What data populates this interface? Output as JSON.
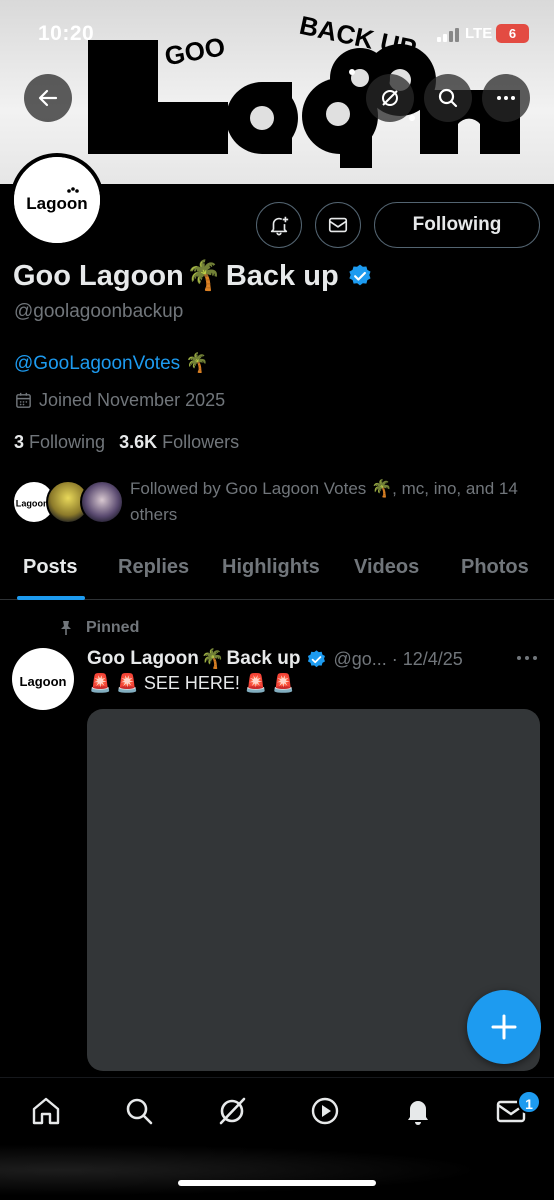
{
  "status_bar": {
    "time": "10:20",
    "network": "LTE",
    "battery": "6"
  },
  "banner": {
    "text_top_left": "GOO",
    "text_top_right": "BACK UP",
    "text_main": "Lagoon"
  },
  "profile": {
    "display_name": "Goo Lagoon",
    "name_suffix": "Back up",
    "palm_emoji": "🌴",
    "handle": "@goolagoonbackup",
    "bio_link": "@GooLagoonVotes",
    "bio_emoji": "🌴",
    "joined": "Joined November 2025",
    "following_count": "3",
    "following_label": "Following",
    "followers_count": "3.6K",
    "followers_label": "Followers",
    "followed_by": "Followed by Goo Lagoon Votes 🌴, mc, ino, and 14 others",
    "follow_button": "Following",
    "avatar_text": "Lagoon"
  },
  "tabs": [
    "Posts",
    "Replies",
    "Highlights",
    "Videos",
    "Photos"
  ],
  "active_tab": "Posts",
  "pinned_post": {
    "pinned_label": "Pinned",
    "author": "Goo Lagoon",
    "author_suffix": "Back up",
    "handle": "@go...",
    "date": "· 12/4/25",
    "text": "🚨 🚨 SEE HERE! 🚨 🚨"
  },
  "bottom_nav": {
    "icons": [
      "home-icon",
      "search-icon",
      "grok-icon",
      "video-icon",
      "notifications-icon",
      "messages-icon"
    ],
    "messages_badge": "1"
  },
  "colors": {
    "accent": "#1d9bf0",
    "background": "#000000",
    "secondary_text": "#71767b",
    "media": "#333638"
  }
}
